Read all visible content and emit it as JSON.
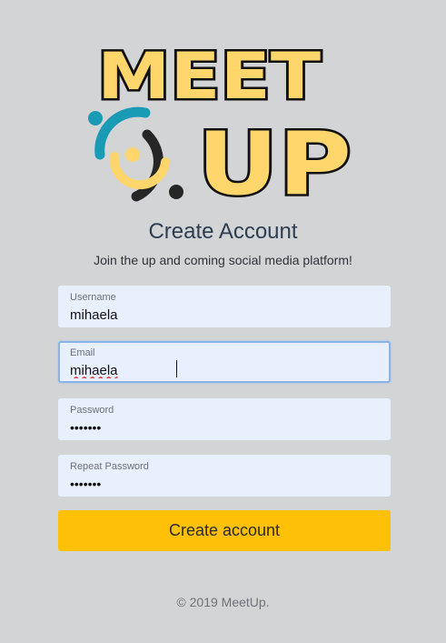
{
  "logo": {
    "top_text": "MEET",
    "bottom_text": "UP",
    "icon": "people-circle-logo-icon"
  },
  "header": {
    "title": "Create Account",
    "subtitle": "Join the up and coming social media platform!"
  },
  "form": {
    "username": {
      "label": "Username",
      "value": "mihaela"
    },
    "email": {
      "label": "Email",
      "value": "mihaela"
    },
    "password": {
      "label": "Password",
      "value": "•••••••"
    },
    "repeat_password": {
      "label": "Repeat Password",
      "value": "•••••••"
    },
    "submit_label": "Create account"
  },
  "footer": {
    "text": "© 2019 MeetUp."
  },
  "colors": {
    "background": "#d3d4d6",
    "field_bg": "#e8f0fe",
    "accent_button": "#ffc107",
    "logo_yellow": "#ffd66b",
    "logo_teal": "#1a9bb5",
    "logo_dark": "#262626"
  }
}
